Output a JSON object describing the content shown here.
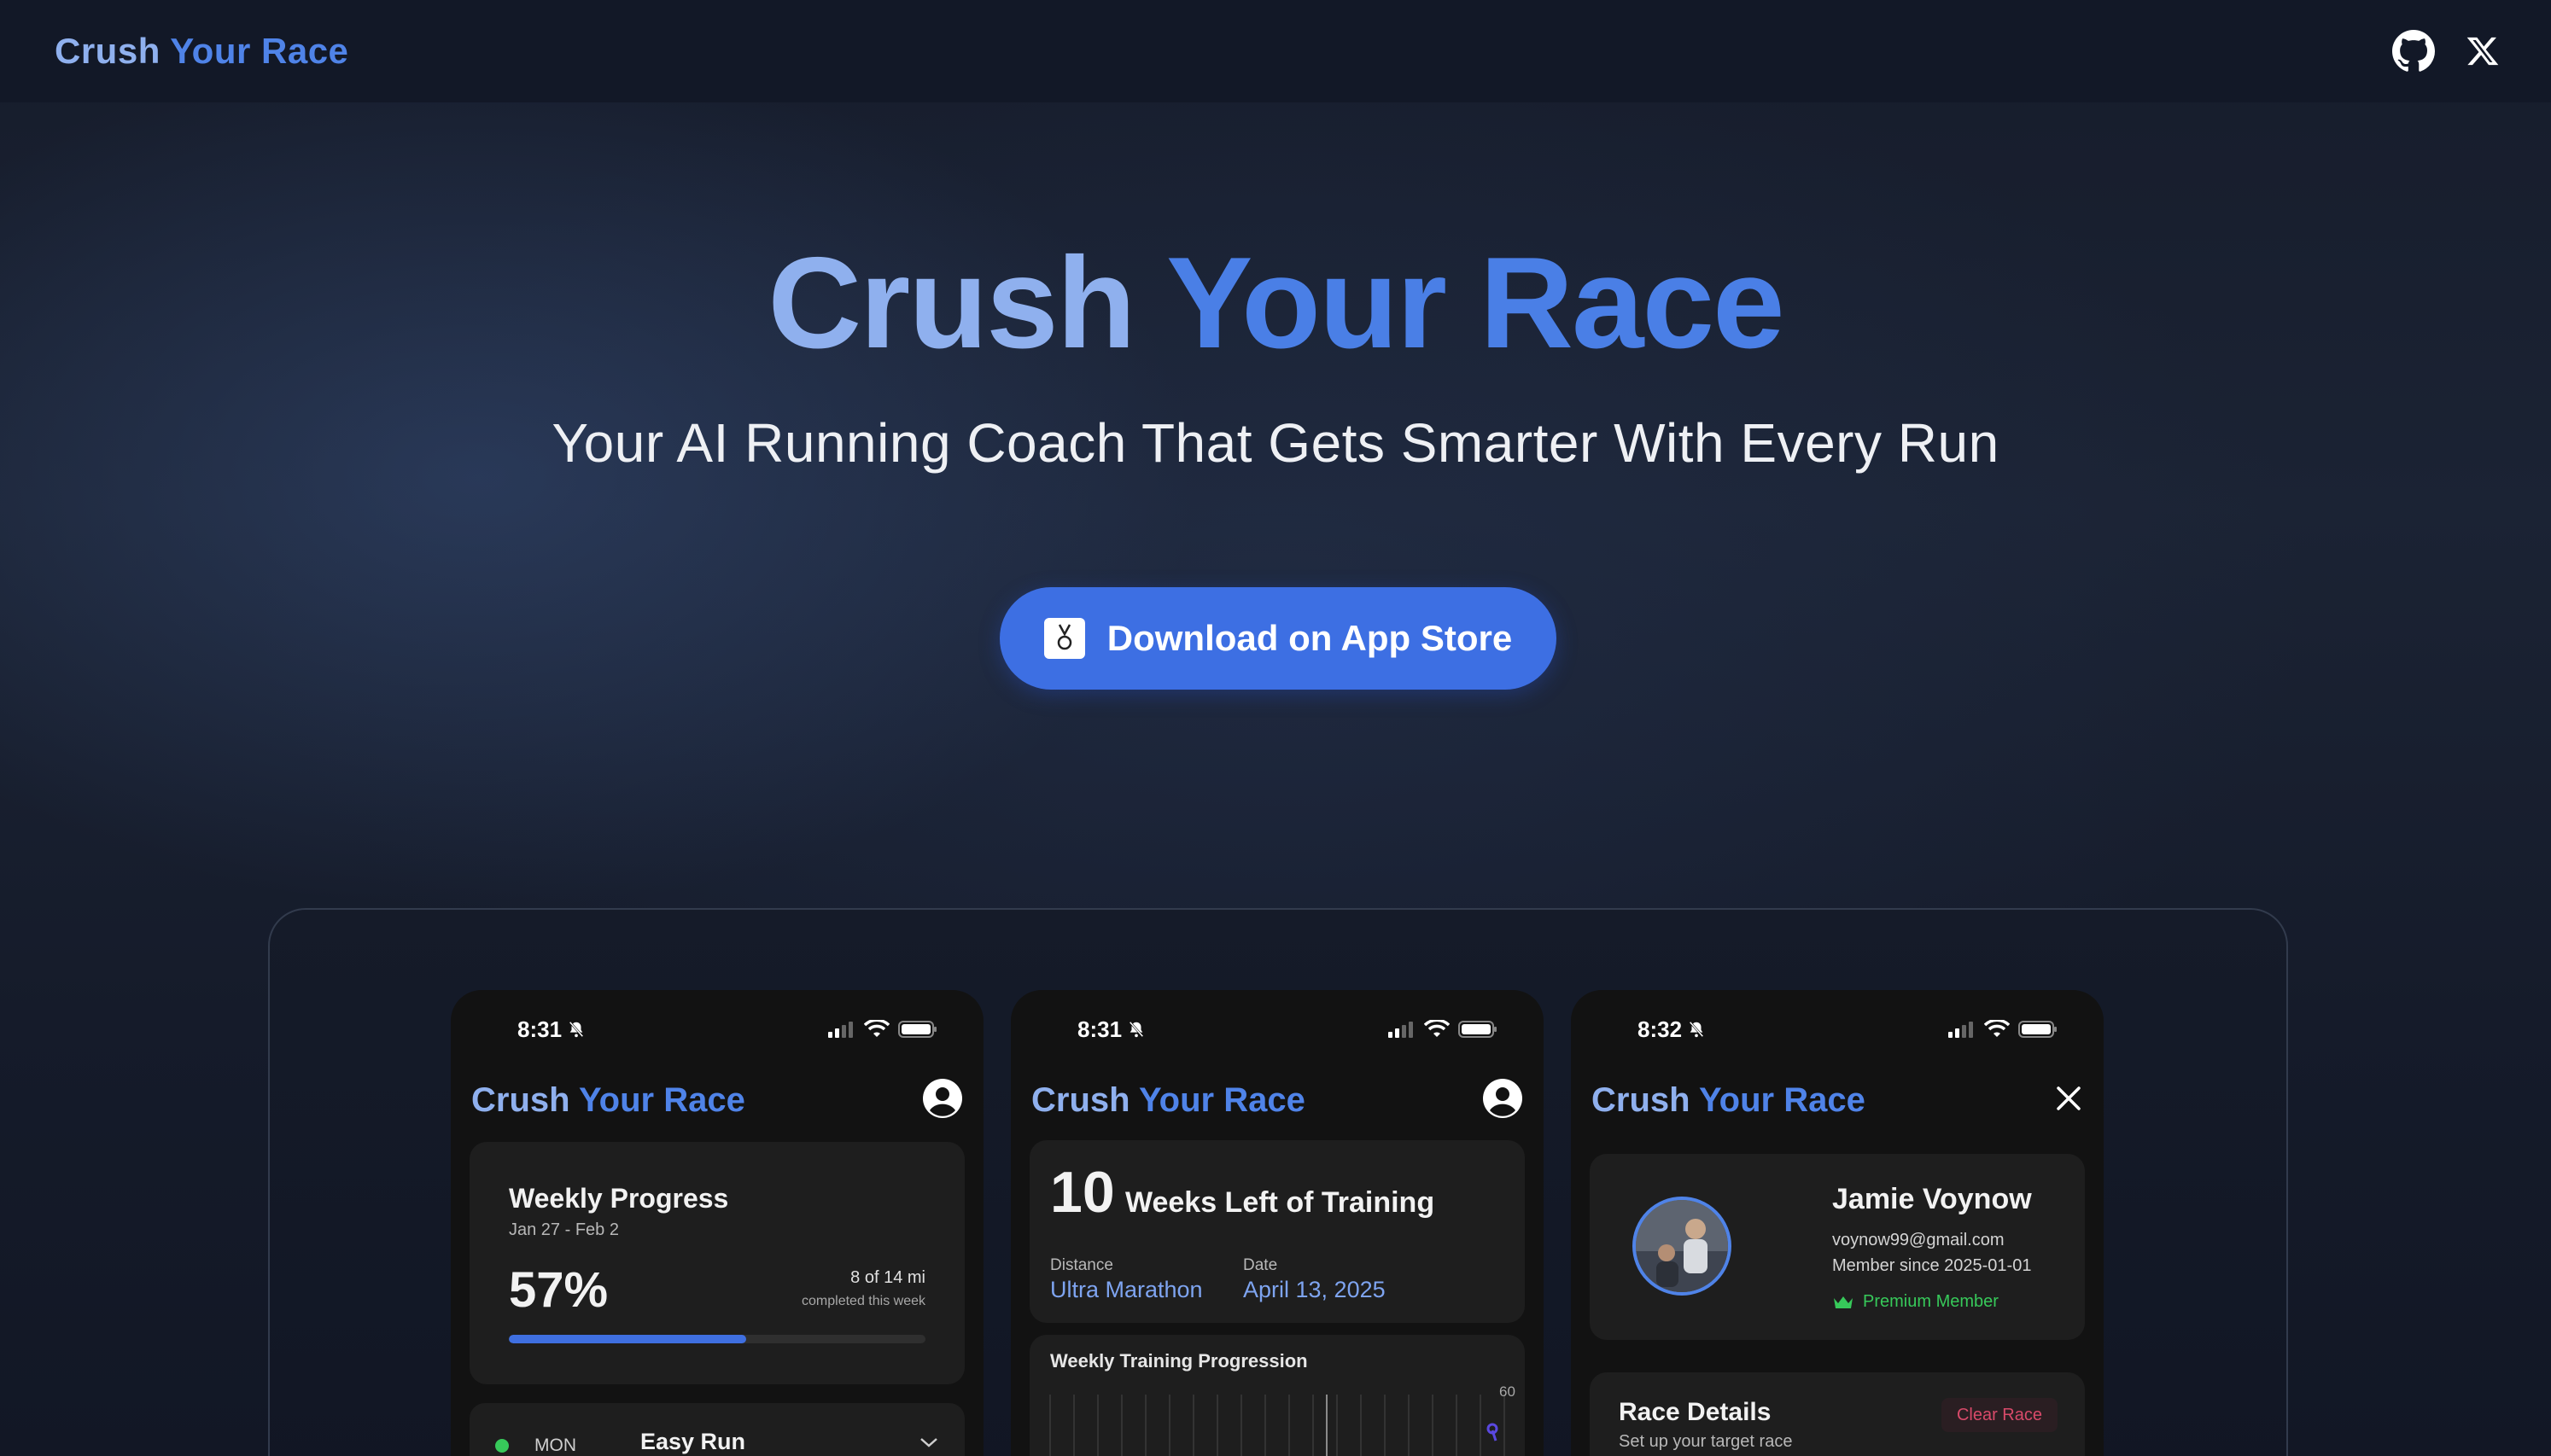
{
  "nav": {
    "brand_part1": "Crush",
    "brand_part2": "Your Race",
    "icons": [
      "github-icon",
      "x-icon"
    ]
  },
  "hero": {
    "title_part1": "Crush",
    "title_part2": "Your Race",
    "subtitle": "Your AI Running Coach That Gets Smarter With Every Run",
    "cta_label": "Download on App Store"
  },
  "colors": {
    "accent_light": "#8fb0ee",
    "accent": "#4f83e8",
    "cta": "#3d6fe3",
    "success": "#37c95a",
    "danger": "#d84a6a"
  },
  "phones": [
    {
      "time": "8:31",
      "brand_part1": "Crush",
      "brand_part2": "Your Race",
      "header_icon": "profile-icon",
      "weekly_progress": {
        "title": "Weekly Progress",
        "date_range": "Jan 27 - Feb 2",
        "percent_label": "57%",
        "percent": 57,
        "miles": "8 of 14 mi",
        "completed": "completed this week"
      },
      "day": {
        "day": "MON",
        "workout": "Easy Run"
      }
    },
    {
      "time": "8:31",
      "brand_part1": "Crush",
      "brand_part2": "Your Race",
      "header_icon": "profile-icon",
      "weeks_left": "10",
      "weeks_left_label": "Weeks Left of Training",
      "distance_label": "Distance",
      "distance_value": "Ultra Marathon",
      "date_label": "Date",
      "date_value": "April 13, 2025",
      "chart_title": "Weekly Training Progression",
      "chart_axis_max": "60"
    },
    {
      "time": "8:32",
      "brand_part1": "Crush",
      "brand_part2": "Your Race",
      "header_icon": "close-icon",
      "profile": {
        "name": "Jamie Voynow",
        "email": "voynow99@gmail.com",
        "member_since": "Member since 2025-01-01",
        "badge": "Premium Member"
      },
      "race_details": {
        "title": "Race Details",
        "subtitle": "Set up your target race",
        "clear_label": "Clear Race"
      }
    }
  ]
}
